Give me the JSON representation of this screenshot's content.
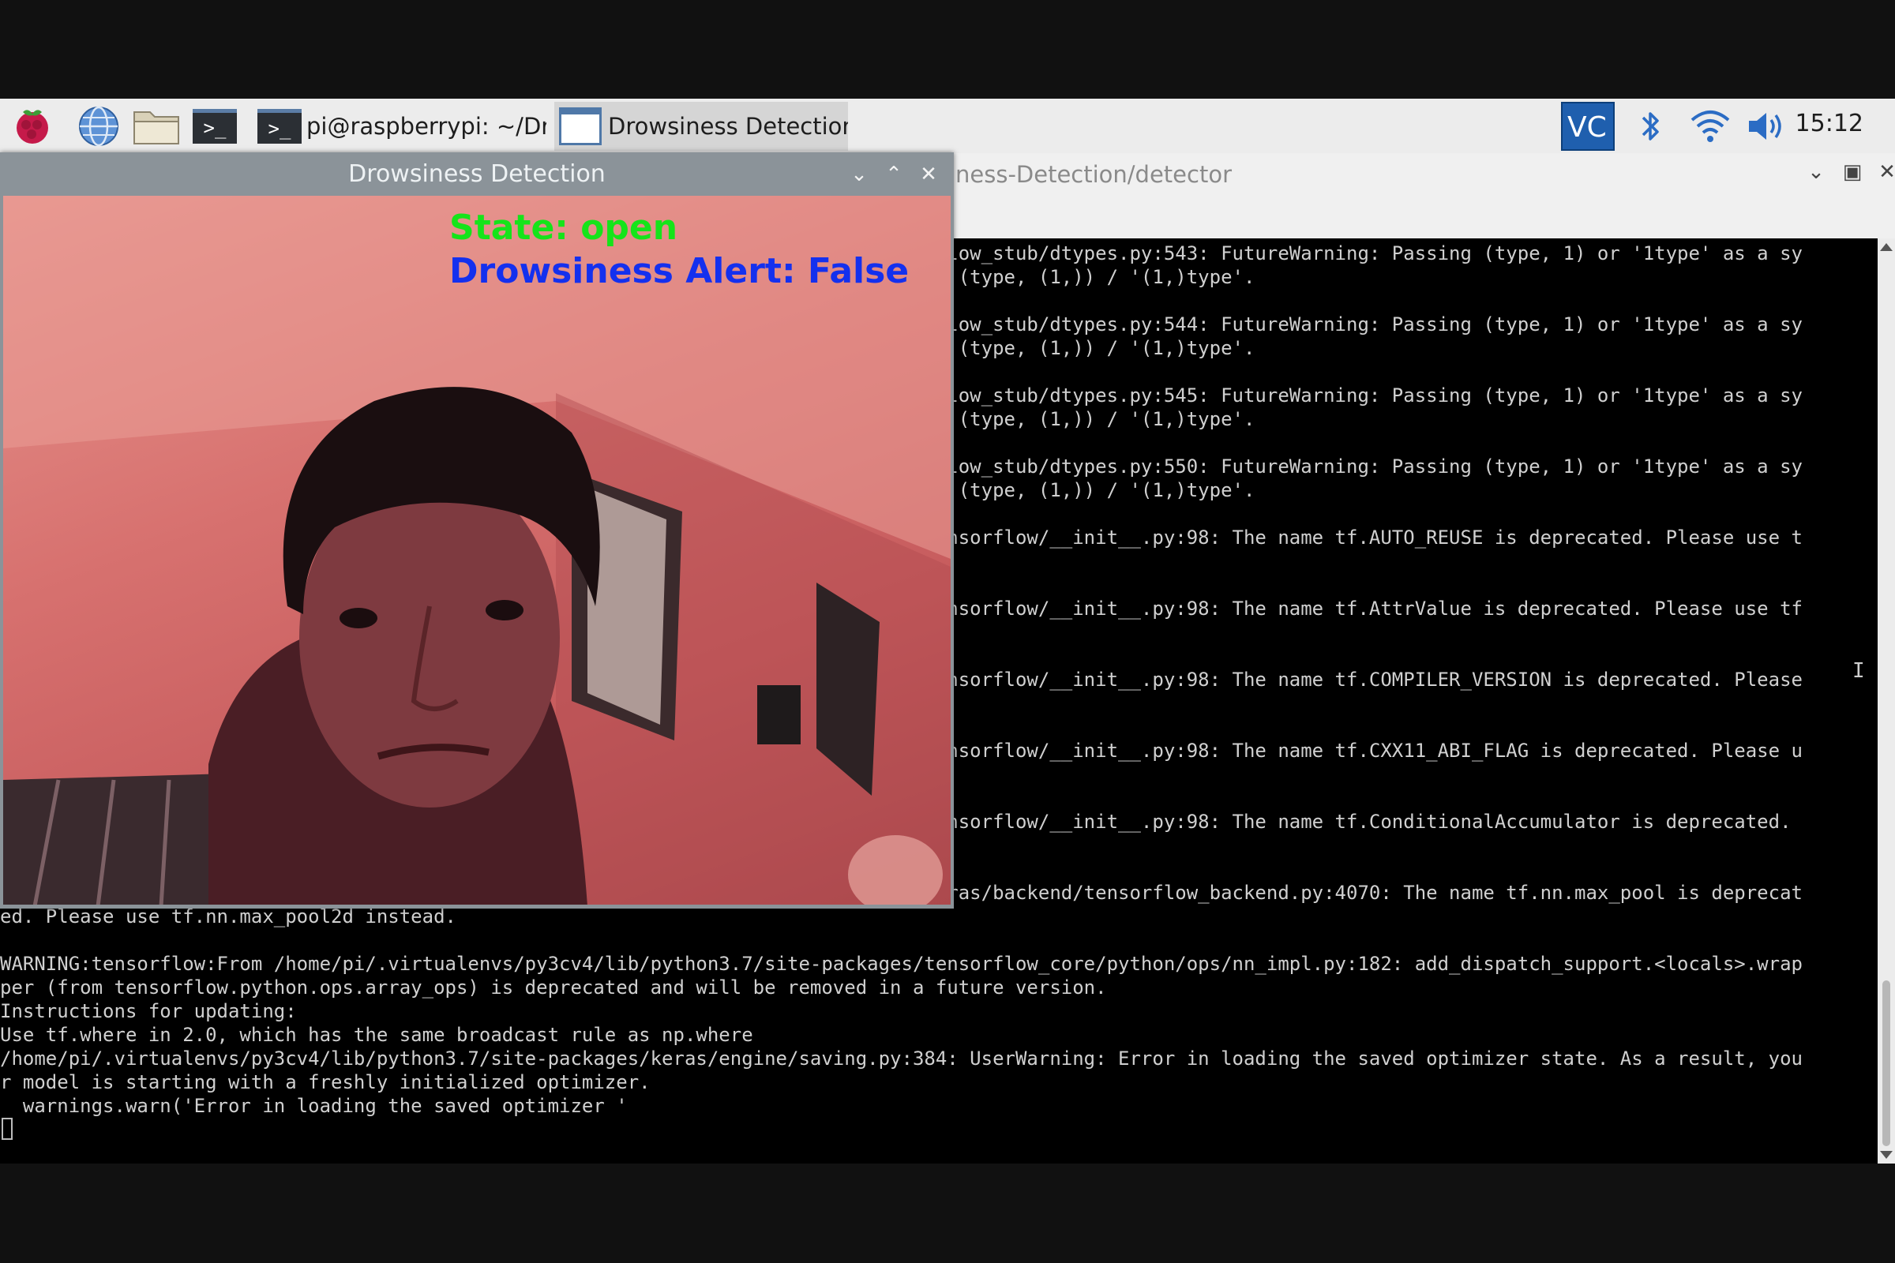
{
  "taskbar": {
    "terminal_task": "pi@raspberrypi: ~/Dr...",
    "drowsiness_task": "Drowsiness Detection",
    "clock": "15:12",
    "icons": [
      "raspberry-menu-icon",
      "browser-icon",
      "file-manager-icon",
      "terminal-icon",
      "vnc-icon",
      "bluetooth-icon",
      "wifi-icon",
      "volume-icon"
    ]
  },
  "terminal_window": {
    "title": "ness-Detection/detector"
  },
  "terminal": {
    "lines": [
      "                                                                                orflow_stub/dtypes.py:543: FutureWarning: Passing (type, 1) or '1type' as a sy",
      "                                                                                 as (type, (1,)) / '(1,)type'.",
      "",
      "                                                                                orflow_stub/dtypes.py:544: FutureWarning: Passing (type, 1) or '1type' as a sy",
      "                                                                                 as (type, (1,)) / '(1,)type'.",
      "",
      "                                                                                orflow_stub/dtypes.py:545: FutureWarning: Passing (type, 1) or '1type' as a sy",
      "                                                                                 as (type, (1,)) / '(1,)type'.",
      "",
      "                                                                                orflow_stub/dtypes.py:550: FutureWarning: Passing (type, 1) or '1type' as a sy",
      "                                                                                 as (type, (1,)) / '(1,)type'.",
      "",
      "                                                                                /tensorflow/__init__.py:98: The name tf.AUTO_REUSE is deprecated. Please use t",
      "",
      "",
      "                                                                                /tensorflow/__init__.py:98: The name tf.AttrValue is deprecated. Please use tf",
      "",
      "",
      "                                                                                /tensorflow/__init__.py:98: The name tf.COMPILER_VERSION is deprecated. Please",
      "",
      "",
      "                                                                                /tensorflow/__init__.py:98: The name tf.CXX11_ABI_FLAG is deprecated. Please u",
      "",
      "",
      "                                                                                /tensorflow/__init__.py:98: The name tf.ConditionalAccumulator is deprecated.",
      "",
      "",
      "                                                                                /keras/backend/tensorflow_backend.py:4070: The name tf.nn.max_pool is deprecat",
      "ed. Please use tf.nn.max_pool2d instead.",
      "",
      "WARNING:tensorflow:From /home/pi/.virtualenvs/py3cv4/lib/python3.7/site-packages/tensorflow_core/python/ops/nn_impl.py:182: add_dispatch_support.<locals>.wrap",
      "per (from tensorflow.python.ops.array_ops) is deprecated and will be removed in a future version.",
      "Instructions for updating:",
      "Use tf.where in 2.0, which has the same broadcast rule as np.where",
      "/home/pi/.virtualenvs/py3cv4/lib/python3.7/site-packages/keras/engine/saving.py:384: UserWarning: Error in loading the saved optimizer state. As a result, you",
      "r model is starting with a freshly initialized optimizer.",
      "  warnings.warn('Error in loading the saved optimizer '"
    ]
  },
  "drowsiness_window": {
    "title": "Drowsiness Detection",
    "state_text": "State: open",
    "alert_text": "Drowsiness Alert: False",
    "state_color": "#15e41a",
    "alert_color": "#1430ee"
  }
}
